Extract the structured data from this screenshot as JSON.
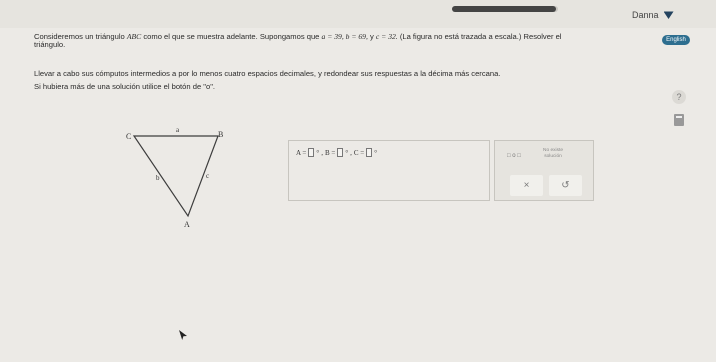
{
  "header": {
    "user_name": "Danna",
    "progress_fraction": 0.98,
    "language_button": "English"
  },
  "problem": {
    "line1": "Consideremos un triángulo",
    "triangle_name": "ABC",
    "line1b": "como el que se muestra adelante. Supongamos que",
    "a_eq": "a = 39, b = 69,",
    "and_word": "y",
    "c_eq": "c = 32.",
    "line1c": "(La figura no está trazada a escala.) Resolver el",
    "line2": "triángulo.",
    "line3": "Llevar a cabo sus cómputos intermedios a por lo menos cuatro espacios decimales, y redondear sus respuestas a la décima más cercana.",
    "line4": "Si hubiera más de una solución utilice el botón de \"o\"."
  },
  "figure": {
    "vertex_c": "C",
    "vertex_b": "B",
    "vertex_a": "A",
    "side_a": "a",
    "side_b": "b",
    "side_c": "c"
  },
  "answer": {
    "a_label": "A =",
    "b_label": "B =",
    "c_label": "C =",
    "degree": "°",
    "comma": ","
  },
  "tools": {
    "or_label": "□ o □",
    "no_solution": "No existe solución",
    "clear_symbol": "×",
    "undo_symbol": "↺"
  },
  "side_tools": {
    "help": "?"
  }
}
